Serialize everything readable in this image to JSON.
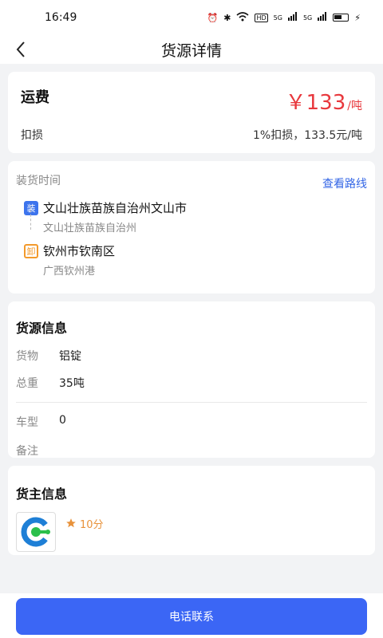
{
  "status_bar": {
    "time": "16:49",
    "network_label": "HD",
    "signal_1": "5G",
    "signal_2": "5G"
  },
  "nav": {
    "title": "货源详情"
  },
  "freight": {
    "title": "运费",
    "price_symbol": "￥",
    "price": "133",
    "unit": "/吨",
    "loss_label": "扣损",
    "loss_value": "1%扣损，133.5元/吨"
  },
  "route": {
    "load_time_label": "装货时间",
    "view_route": "查看路线",
    "load": {
      "badge": "装",
      "city": "文山壮族苗族自治州文山市",
      "address": "文山壮族苗族自治州"
    },
    "unload": {
      "badge": "卸",
      "city": "钦州市钦南区",
      "address": "广西钦州港"
    }
  },
  "cargo": {
    "title": "货源信息",
    "items": [
      {
        "label": "货物",
        "value": "铝锭"
      },
      {
        "label": "总重",
        "value": "35吨"
      },
      {
        "label": "车型",
        "value": "0"
      },
      {
        "label": "备注",
        "value": ""
      }
    ]
  },
  "owner": {
    "title": "货主信息",
    "rating": "10分"
  },
  "actions": {
    "call": "电话联系"
  },
  "colors": {
    "accent": "#3b66f5",
    "price": "#e8383d",
    "rating": "#e8923b"
  }
}
